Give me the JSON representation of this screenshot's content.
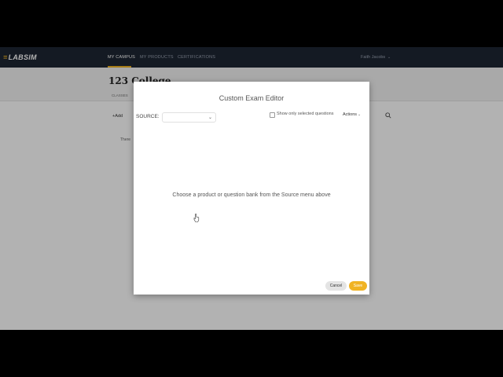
{
  "colors": {
    "nav_bg": "#1e2633",
    "accent": "#f0b323",
    "subheader_bg": "#f2f2f2"
  },
  "nav": {
    "logo": "LABSIM",
    "items": [
      {
        "label": "MY CAMPUS",
        "active": true
      },
      {
        "label": "MY PRODUCTS",
        "active": false
      },
      {
        "label": "CERTIFICATIONS",
        "active": false
      }
    ],
    "user_name": "Faith Jacobs"
  },
  "campus": {
    "title": "123 College",
    "tab": "CLASSES"
  },
  "background": {
    "add_label": "+Add",
    "text": "There"
  },
  "modal": {
    "title": "Custom Exam Editor",
    "source_label": "SOURCE:",
    "source_value": "",
    "show_selected_label": "Show only selected questions",
    "show_selected_checked": false,
    "actions_label": "Actions",
    "empty_message": "Choose a product or question bank from the Source menu above",
    "cancel_label": "Cancel",
    "save_label": "Save"
  },
  "icons": [
    "logo-bars-icon",
    "chevron-down-icon",
    "search-icon",
    "pointer-cursor-icon"
  ]
}
